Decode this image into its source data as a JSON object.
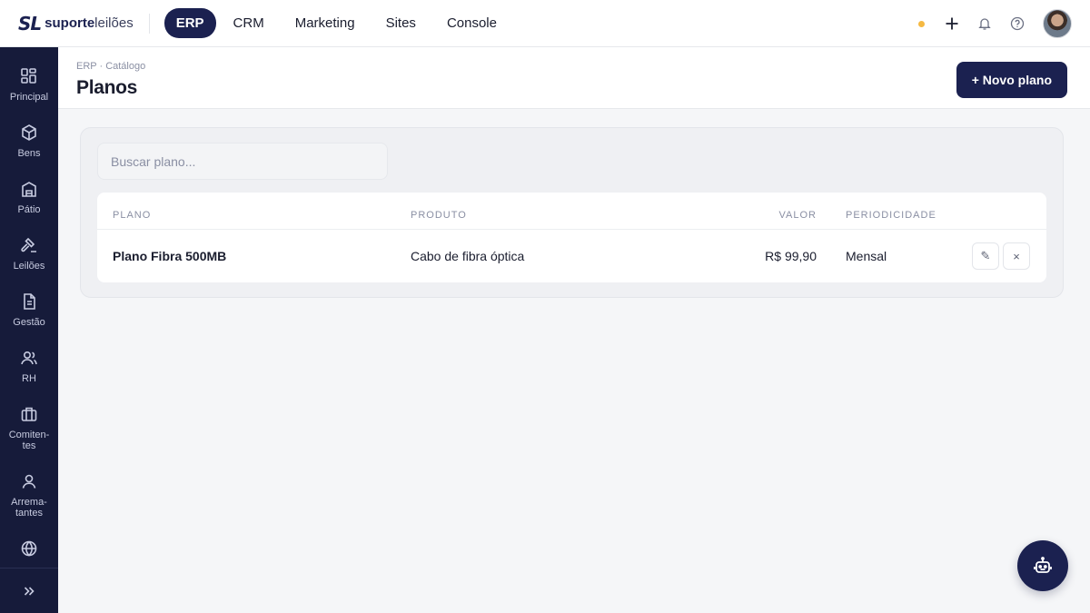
{
  "brand": {
    "mark": "SL",
    "name_bold": "suporte",
    "name_light": "leilões"
  },
  "topnav": [
    {
      "label": "ERP",
      "active": true
    },
    {
      "label": "CRM",
      "active": false
    },
    {
      "label": "Marketing",
      "active": false
    },
    {
      "label": "Sites",
      "active": false
    },
    {
      "label": "Console",
      "active": false
    }
  ],
  "top_actions": {
    "status_color": "#f5b942",
    "icons": [
      "plus-icon",
      "bell-icon",
      "help-icon"
    ]
  },
  "sidebar": {
    "items": [
      {
        "label": "Principal",
        "icon": "dashboard-icon"
      },
      {
        "label": "Bens",
        "icon": "box-icon"
      },
      {
        "label": "Pátio",
        "icon": "warehouse-icon"
      },
      {
        "label": "Leilões",
        "icon": "gavel-icon"
      },
      {
        "label": "Gestão",
        "icon": "document-icon"
      },
      {
        "label": "RH",
        "icon": "users-icon"
      },
      {
        "label": "Comiten-\ntes",
        "icon": "briefcase-icon"
      },
      {
        "label": "Arrema-\ntantes",
        "icon": "user-icon"
      },
      {
        "label": "",
        "icon": "globe-icon"
      }
    ],
    "expand_icon": "double-chevron-right-icon"
  },
  "header": {
    "breadcrumb": "ERP · Catálogo",
    "title": "Planos",
    "new_button": "+ Novo plano"
  },
  "search": {
    "placeholder": "Buscar plano...",
    "value": ""
  },
  "table": {
    "columns": [
      "PLANO",
      "PRODUTO",
      "VALOR",
      "PERIODICIDADE"
    ],
    "rows": [
      {
        "plano": "Plano Fibra 500MB",
        "produto": "Cabo de fibra óptica",
        "valor": "R$ 99,90",
        "periodicidade": "Mensal"
      }
    ],
    "actions": {
      "edit_glyph": "✎",
      "delete_glyph": "×"
    }
  },
  "colors": {
    "brand": "#1b2150",
    "sidebar": "#161b3a",
    "accent_dot": "#f5b942"
  }
}
